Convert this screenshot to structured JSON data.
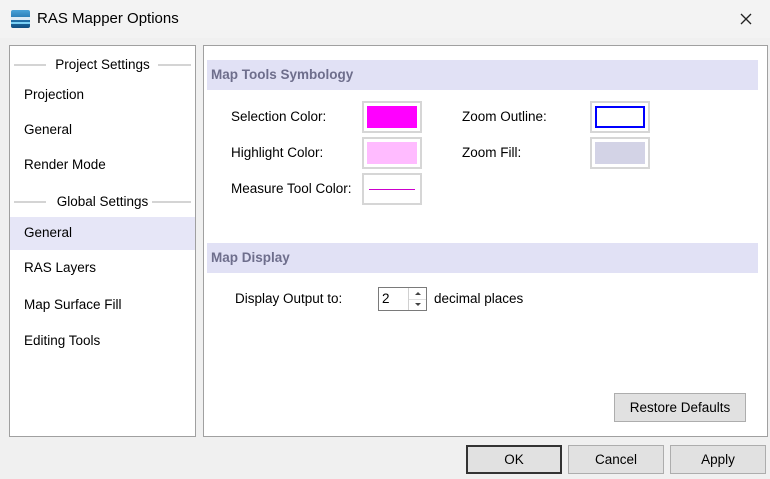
{
  "window": {
    "title": "RAS Mapper Options"
  },
  "sidebar": {
    "groups": [
      {
        "header": "Project Settings",
        "items": [
          "Projection",
          "General",
          "Render Mode"
        ]
      },
      {
        "header": "Global Settings",
        "items": [
          "General",
          "RAS Layers",
          "Map Surface Fill",
          "Editing Tools"
        ]
      }
    ],
    "selected": "Global Settings / General"
  },
  "map_tools": {
    "header": "Map Tools Symbology",
    "selection_color_label": "Selection Color:",
    "highlight_color_label": "Highlight Color:",
    "measure_tool_color_label": "Measure Tool Color:",
    "zoom_outline_label": "Zoom Outline:",
    "zoom_fill_label": "Zoom Fill:",
    "colors": {
      "selection": "#ff00ff",
      "highlight": "#ffbbff",
      "measure_tool": "#cc00cc",
      "zoom_outline": "#0000ff",
      "zoom_fill": "#d3d3e6"
    }
  },
  "map_display": {
    "header": "Map Display",
    "display_output_label": "Display Output to:",
    "decimal_value": "2",
    "decimal_suffix": "decimal places"
  },
  "buttons": {
    "restore_defaults": "Restore Defaults",
    "ok": "OK",
    "cancel": "Cancel",
    "apply": "Apply"
  }
}
